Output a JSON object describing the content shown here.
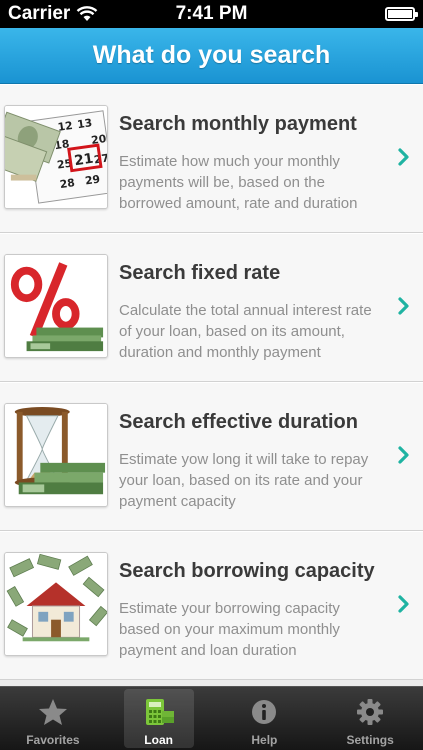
{
  "status_bar": {
    "carrier": "Carrier",
    "time": "7:41 PM"
  },
  "header": {
    "title": "What do you search"
  },
  "items": [
    {
      "title": "Search monthly payment",
      "description": "Estimate how much your monthly payments will be, based on the borrowed amount, rate and duration",
      "icon": "calendar-money-icon"
    },
    {
      "title": "Search fixed rate",
      "description": "Calculate the total annual interest rate of your loan, based on its amount, duration and monthly payment",
      "icon": "percent-money-icon"
    },
    {
      "title": "Search effective duration",
      "description": "Estimate yow long it will take to repay your loan, based on its rate and your payment capacity",
      "icon": "hourglass-money-icon"
    },
    {
      "title": "Search borrowing capacity",
      "description": "Estimate your borrowing capacity based on your maximum monthly payment and loan duration",
      "icon": "house-money-icon"
    }
  ],
  "calendar_day": "21",
  "tabs": [
    {
      "label": "Favorites",
      "icon": "star-icon"
    },
    {
      "label": "Loan",
      "icon": "calculator-icon",
      "active": true
    },
    {
      "label": "Help",
      "icon": "info-icon"
    },
    {
      "label": "Settings",
      "icon": "gear-icon"
    }
  ],
  "colors": {
    "header": "#1a93d2",
    "chevron": "#1fb3a2",
    "title_text": "#3a3a3a",
    "desc_text": "#8f8f8f"
  }
}
